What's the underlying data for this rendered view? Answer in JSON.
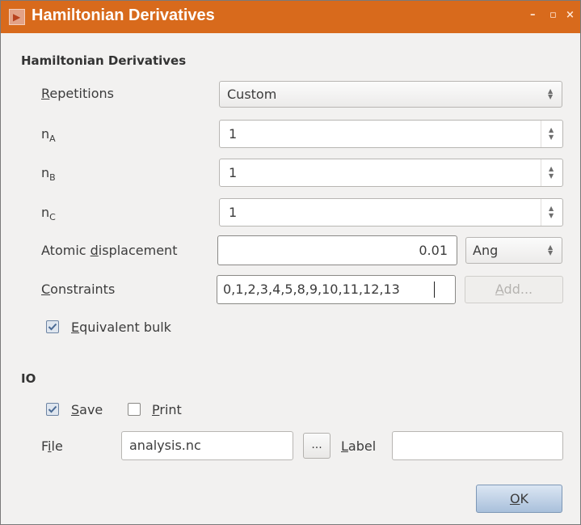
{
  "window": {
    "title": "Hamiltonian Derivatives",
    "minimize_glyph": "–",
    "maximize_glyph": "▫",
    "close_glyph": "×"
  },
  "section_main": {
    "title": "Hamiltonian Derivatives"
  },
  "repetitions": {
    "label_mn": "R",
    "label_rest": "epetitions",
    "value": "Custom"
  },
  "na": {
    "label": "n",
    "sub": "A",
    "value": "1"
  },
  "nb": {
    "label": "n",
    "sub": "B",
    "value": "1"
  },
  "nc": {
    "label": "n",
    "sub": "C",
    "value": "1"
  },
  "displacement": {
    "label_a": "Atomic ",
    "label_mn": "d",
    "label_b": "isplacement",
    "value": "0.01",
    "unit": "Ang"
  },
  "constraints": {
    "label_mn": "C",
    "label_rest": "onstraints",
    "value": "0,1,2,3,4,5,8,9,10,11,12,13",
    "add_mn": "A",
    "add_rest": "dd..."
  },
  "equivalent_bulk": {
    "label_mn": "E",
    "label_rest": "quivalent bulk",
    "checked": true
  },
  "section_io": {
    "title": "IO"
  },
  "save": {
    "label_mn": "S",
    "label_rest": "ave",
    "checked": true
  },
  "print": {
    "label_mn": "P",
    "label_rest": "rint",
    "checked": false
  },
  "file": {
    "label_a": "F",
    "label_mn": "i",
    "label_b": "le",
    "value": "analysis.nc",
    "browse_label": "..."
  },
  "label_field": {
    "label_mn": "L",
    "label_rest": "abel",
    "value": ""
  },
  "ok": {
    "label_mn": "O",
    "label_rest": "K"
  },
  "colors": {
    "titlebar": "#d86a1c",
    "background": "#f2f1f0",
    "check_accent": "#4a6a94"
  }
}
